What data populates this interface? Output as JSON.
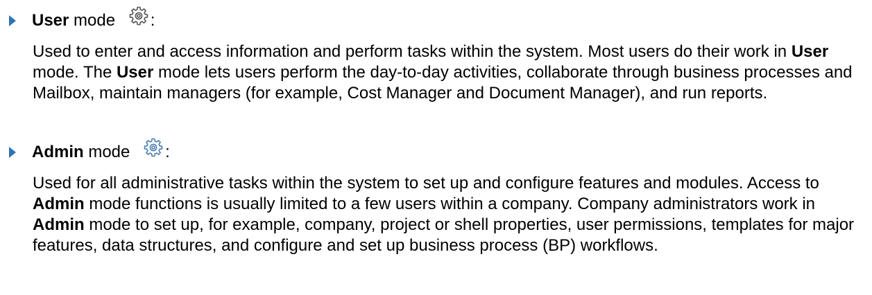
{
  "modes": [
    {
      "name": "User",
      "suffix": "mode",
      "colon": ":",
      "icon": "gear-icon",
      "description": [
        {
          "text": "Used to enter and access information and perform tasks within the system. Most users do their work in ",
          "bold": false
        },
        {
          "text": "User",
          "bold": true
        },
        {
          "text": " mode. The ",
          "bold": false
        },
        {
          "text": "User",
          "bold": true
        },
        {
          "text": " mode lets users perform the day-to-day activities, collaborate through business processes and Mailbox, maintain managers (for example, Cost Manager and Document Manager), and run reports.",
          "bold": false
        }
      ]
    },
    {
      "name": "Admin",
      "suffix": "mode",
      "colon": ":",
      "icon": "gear-icon",
      "description": [
        {
          "text": "Used for all administrative tasks within the system to set up and configure features and modules. Access to ",
          "bold": false
        },
        {
          "text": "Admin",
          "bold": true
        },
        {
          "text": " mode functions is usually limited to a few users within a company. Company administrators work in ",
          "bold": false
        },
        {
          "text": "Admin",
          "bold": true
        },
        {
          "text": " mode to set up, for example, company, project or shell properties, user permissions, templates for major features, data structures, and configure and set up business process (BP) workflows.",
          "bold": false
        }
      ]
    }
  ],
  "colors": {
    "bullet_arrow": "#2e74b5",
    "text": "#000000"
  }
}
